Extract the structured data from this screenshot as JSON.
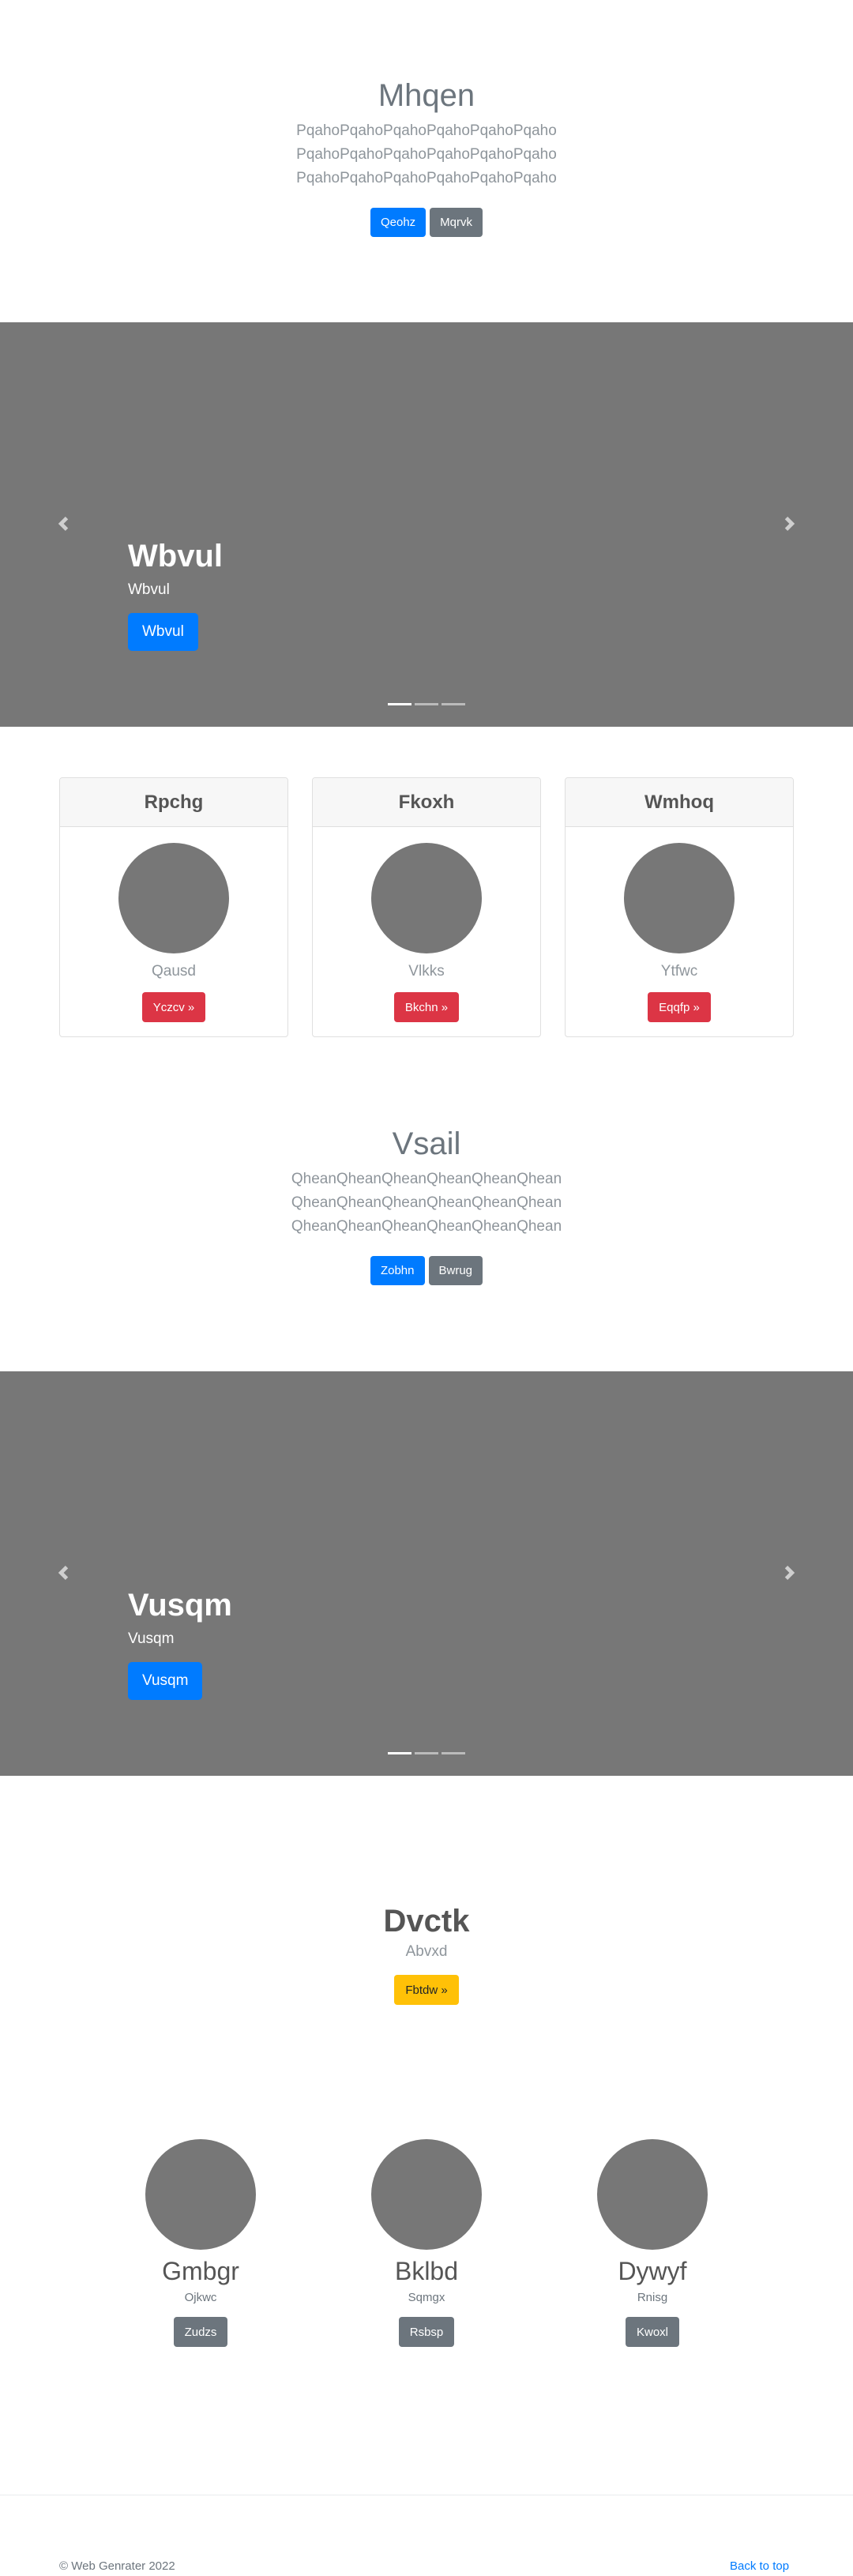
{
  "hero1": {
    "title": "Mhqen",
    "lines": [
      "PqahoPqahoPqahoPqahoPqahoPqaho",
      "PqahoPqahoPqahoPqahoPqahoPqaho",
      "PqahoPqahoPqahoPqahoPqahoPqaho"
    ],
    "primary_btn": "Qeohz",
    "secondary_btn": "Mqrvk"
  },
  "carousel1": {
    "title": "Wbvul",
    "subtitle": "Wbvul",
    "button": "Wbvul",
    "indicators": 3,
    "active_indicator": 0
  },
  "cards": [
    {
      "header": "Rpchg",
      "text": "Qausd",
      "button": "Yczcv »"
    },
    {
      "header": "Fkoxh",
      "text": "Vlkks",
      "button": "Bkchn »"
    },
    {
      "header": "Wmhoq",
      "text": "Ytfwc",
      "button": "Eqqfp »"
    }
  ],
  "hero2": {
    "title": "Vsail",
    "lines": [
      "QheanQheanQheanQheanQheanQhean",
      "QheanQheanQheanQheanQheanQhean",
      "QheanQheanQheanQheanQheanQhean"
    ],
    "primary_btn": "Zobhn",
    "secondary_btn": "Bwrug"
  },
  "carousel2": {
    "title": "Vusqm",
    "subtitle": "Vusqm",
    "button": "Vusqm",
    "indicators": 3,
    "active_indicator": 0
  },
  "feature": {
    "title": "Dvctk",
    "subtitle": "Abvxd",
    "button": "Fbtdw »"
  },
  "profiles": [
    {
      "name": "Gmbgr",
      "role": "Ojkwc",
      "button": "Zudzs"
    },
    {
      "name": "Bklbd",
      "role": "Sqmgx",
      "button": "Rsbsp"
    },
    {
      "name": "Dywyf",
      "role": "Rnisg",
      "button": "Kwoxl"
    }
  ],
  "footer": {
    "copyright": "© Web Genrater 2022",
    "back_to_top": "Back to top"
  },
  "colors": {
    "primary": "#007bff",
    "secondary": "#6c757d",
    "danger": "#dc3545",
    "warning": "#ffc107",
    "placeholder": "#777777"
  }
}
